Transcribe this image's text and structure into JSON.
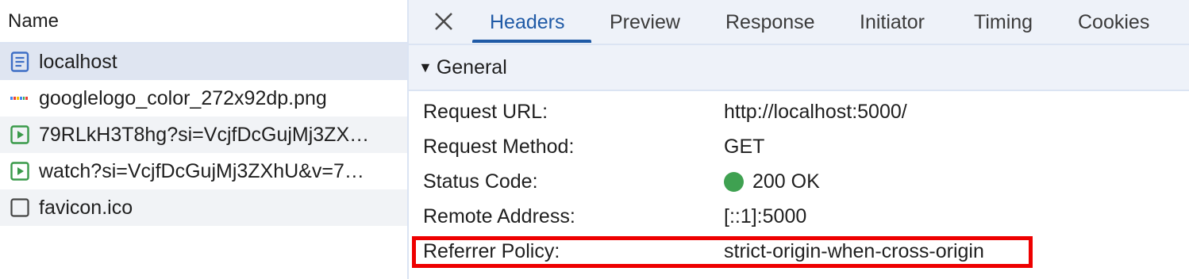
{
  "request_list": {
    "header": "Name",
    "items": [
      {
        "name": "localhost",
        "icon": "document-icon"
      },
      {
        "name": "googlelogo_color_272x92dp.png",
        "icon": "google-image-icon"
      },
      {
        "name": "79RLkH3T8hg?si=VcjfDcGujMj3ZX…",
        "icon": "media-play-icon"
      },
      {
        "name": "watch?si=VcjfDcGujMj3ZXhU&v=7…",
        "icon": "media-play-icon"
      },
      {
        "name": "favicon.ico",
        "icon": "blank-file-icon"
      }
    ]
  },
  "tabs": {
    "close_icon": "close-icon",
    "items": [
      "Headers",
      "Preview",
      "Response",
      "Initiator",
      "Timing",
      "Cookies"
    ],
    "active": "Headers"
  },
  "general": {
    "title": "General",
    "rows": [
      {
        "key": "Request URL:",
        "value": "http://localhost:5000/"
      },
      {
        "key": "Request Method:",
        "value": "GET"
      },
      {
        "key": "Status Code:",
        "value": "200 OK"
      },
      {
        "key": "Remote Address:",
        "value": "[::1]:5000"
      },
      {
        "key": "Referrer Policy:",
        "value": "strict-origin-when-cross-origin"
      }
    ]
  },
  "colors": {
    "accent": "#1f5aa6",
    "status_ok": "#3fa151",
    "highlight": "#ee0000"
  }
}
